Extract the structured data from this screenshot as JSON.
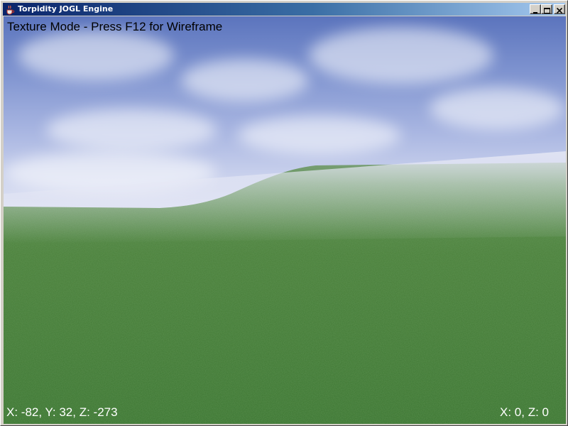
{
  "window": {
    "title": "Torpidity JOGL Engine",
    "app_icon": "java-cup-icon",
    "controls": {
      "minimize_icon": "minimize-icon",
      "maximize_icon": "maximize-icon",
      "close_icon": "close-icon"
    }
  },
  "hud": {
    "mode_text": "Texture Mode - Press F12 for Wireframe",
    "position_text": "X: -82, Y: 32, Z: -273",
    "grid_text": "X: 0, Z: 0"
  },
  "scene": {
    "sky_color": "#7d92cf",
    "horizon_color": "#e6e8f5",
    "grass_color": "#3f7a32"
  }
}
